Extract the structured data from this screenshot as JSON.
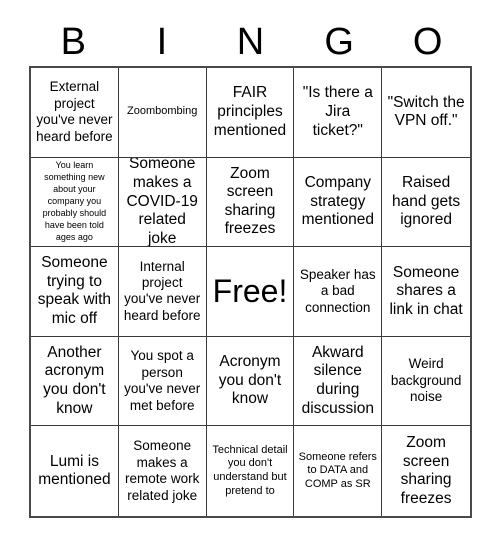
{
  "card": {
    "title": "BINGO",
    "header_letters": [
      "B",
      "I",
      "N",
      "G",
      "O"
    ],
    "rows": [
      [
        {
          "text": "External project you've never heard before",
          "size": "md"
        },
        {
          "text": "Zoombombing",
          "size": "sm"
        },
        {
          "text": "FAIR principles mentioned",
          "size": "lg"
        },
        {
          "text": "\"Is there a Jira ticket?\"",
          "size": "lg"
        },
        {
          "text": "\"Switch the VPN off.\"",
          "size": "lg"
        }
      ],
      [
        {
          "text": "You learn something new about your company you probably should have been told ages ago",
          "size": "xs"
        },
        {
          "text": "Someone makes a COVID-19 related joke",
          "size": "lg"
        },
        {
          "text": "Zoom screen sharing freezes",
          "size": "lg"
        },
        {
          "text": "Company strategy mentioned",
          "size": "lg"
        },
        {
          "text": "Raised hand gets ignored",
          "size": "lg"
        }
      ],
      [
        {
          "text": "Someone trying to speak with mic off",
          "size": "lg"
        },
        {
          "text": "Internal project you've never heard before",
          "size": "md"
        },
        {
          "text": "Free!",
          "size": "free"
        },
        {
          "text": "Speaker has a bad connection",
          "size": "md"
        },
        {
          "text": "Someone shares a link in chat",
          "size": "lg"
        }
      ],
      [
        {
          "text": "Another acronym you don't know",
          "size": "lg"
        },
        {
          "text": "You spot a person you've never met before",
          "size": "md"
        },
        {
          "text": "Acronym you don't know",
          "size": "lg"
        },
        {
          "text": "Akward silence during discussion",
          "size": "lg"
        },
        {
          "text": "Weird background noise",
          "size": "md"
        }
      ],
      [
        {
          "text": "Lumi is mentioned",
          "size": "lg"
        },
        {
          "text": "Someone makes a remote work related joke",
          "size": "md"
        },
        {
          "text": "Technical detail you don't understand but pretend to",
          "size": "sm"
        },
        {
          "text": "Someone refers to DATA and COMP as SR",
          "size": "sm"
        },
        {
          "text": "Zoom screen sharing freezes",
          "size": "lg"
        }
      ]
    ],
    "colors": {
      "background": "#ffffff",
      "text": "#000000",
      "grid_line": "#3a3a3a",
      "outer_border": "#4a4a4a"
    }
  }
}
